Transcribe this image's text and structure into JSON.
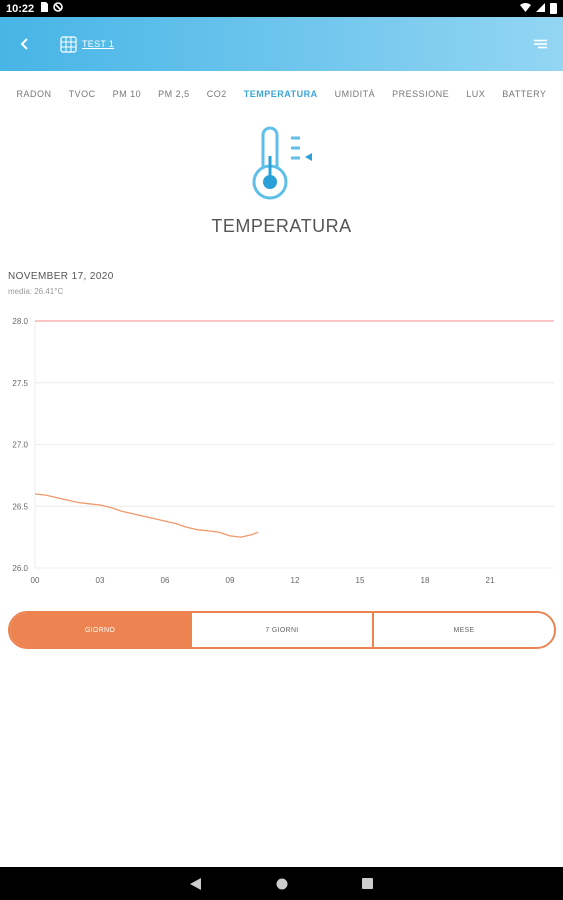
{
  "status_bar": {
    "time": "10:22",
    "icons": [
      "sim-card-icon",
      "no-sync-icon"
    ],
    "right_icons": [
      "wifi-icon",
      "cell-signal-icon",
      "battery-icon"
    ]
  },
  "app_bar": {
    "device_title": "TEST 1",
    "icons": {
      "back": "back-arrow-icon",
      "device": "grid-device-icon",
      "menu": "menu-icon"
    }
  },
  "tabs": [
    {
      "label": "RADON",
      "active": false
    },
    {
      "label": "TVOC",
      "active": false
    },
    {
      "label": "PM 10",
      "active": false
    },
    {
      "label": "PM 2,5",
      "active": false
    },
    {
      "label": "CO2",
      "active": false
    },
    {
      "label": "TEMPERATURA",
      "active": true
    },
    {
      "label": "UMIDITÀ",
      "active": false
    },
    {
      "label": "PRESSIONE",
      "active": false
    },
    {
      "label": "LUX",
      "active": false
    },
    {
      "label": "BATTERY",
      "active": false
    }
  ],
  "sensor": {
    "title": "TEMPERATURA",
    "icon": "thermometer-icon"
  },
  "reading": {
    "date": "NOVEMBER 17, 2020",
    "average": "media: 26.41°C"
  },
  "chart_data": {
    "type": "line",
    "x_ticks": [
      "00",
      "03",
      "06",
      "09",
      "12",
      "15",
      "18",
      "21"
    ],
    "y_ticks": [
      "26.0",
      "26.5",
      "27.0",
      "27.5",
      "28.0"
    ],
    "xlim": [
      0,
      24
    ],
    "ylim": [
      26.0,
      28.0
    ],
    "grid": true,
    "threshold": {
      "value": 28.0,
      "color": "#f5a5a5"
    },
    "series": [
      {
        "color": "#f0996a",
        "points": [
          [
            0.0,
            26.6
          ],
          [
            0.5,
            26.59
          ],
          [
            1.0,
            26.57
          ],
          [
            1.5,
            26.55
          ],
          [
            2.0,
            26.53
          ],
          [
            2.5,
            26.52
          ],
          [
            3.0,
            26.51
          ],
          [
            3.5,
            26.49
          ],
          [
            4.0,
            26.46
          ],
          [
            4.5,
            26.44
          ],
          [
            5.0,
            26.42
          ],
          [
            5.5,
            26.4
          ],
          [
            6.0,
            26.38
          ],
          [
            6.5,
            26.36
          ],
          [
            7.0,
            26.33
          ],
          [
            7.5,
            26.31
          ],
          [
            8.0,
            26.3
          ],
          [
            8.5,
            26.29
          ],
          [
            9.0,
            26.26
          ],
          [
            9.5,
            26.25
          ],
          [
            10.0,
            26.27
          ],
          [
            10.3,
            26.29
          ]
        ]
      }
    ]
  },
  "period": {
    "options": [
      {
        "label": "GIORNO",
        "active": true
      },
      {
        "label": "7 GIORNI",
        "active": false
      },
      {
        "label": "MESE",
        "active": false
      }
    ]
  },
  "colors": {
    "header_start": "#47b5e6",
    "header_end": "#93d6f3",
    "active_tab": "#3aa5d8",
    "accent": "#ec8350",
    "line": "#f0996a",
    "threshold": "#f5a5a5"
  },
  "nav": [
    "nav-back-icon",
    "nav-home-icon",
    "nav-recents-icon"
  ]
}
